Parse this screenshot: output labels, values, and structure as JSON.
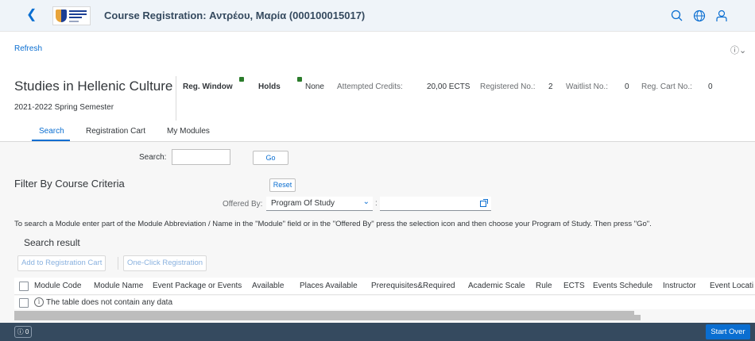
{
  "shell": {
    "title": "Course Registration: Αντρέου, Μαρία (000100015017)",
    "back_icon": "chevron-left-icon",
    "icons": [
      "search-icon",
      "globe-icon",
      "user-icon"
    ]
  },
  "refresh_label": "Refresh",
  "header": {
    "program_title": "Studies in Hellenic Culture",
    "semester": "2021-2022 Spring Semester",
    "reg_window_label": "Reg. Window",
    "holds_label": "Holds",
    "holds_value": "None",
    "attempted_credits_label": "Attempted Credits:",
    "attempted_credits_value": "20,00 ECTS",
    "registered_no_label": "Registered No.:",
    "registered_no_value": "2",
    "waitlist_no_label": "Waitlist No.:",
    "waitlist_no_value": "0",
    "reg_cart_no_label": "Reg. Cart No.:",
    "reg_cart_no_value": "0",
    "status_color": "#2b7c2b"
  },
  "tabs": [
    {
      "label": "Search",
      "active": true
    },
    {
      "label": "Registration Cart",
      "active": false
    },
    {
      "label": "My Modules",
      "active": false
    }
  ],
  "search": {
    "label": "Search:",
    "value": "",
    "go_label": "Go"
  },
  "filter": {
    "title": "Filter By Course Criteria",
    "reset_label": "Reset",
    "offered_by_label": "Offered By:",
    "offered_by_value": "Program Of Study",
    "offered_colon": ":",
    "offered_input_value": ""
  },
  "instructions": "To search a Module enter part of the Module Abbreviation / Name in the \"Module\" field or in the \"Offered By\" press the selection icon and then choose your Program of Study. Then press \"Go\".",
  "results": {
    "title": "Search result",
    "add_to_cart_label": "Add to Registration Cart",
    "one_click_label": "One-Click Registration",
    "columns": [
      "Module Code",
      "Module Name",
      "Event Package or Events",
      "Available",
      "Places Available",
      "Prerequisites&Required",
      "Academic Scale",
      "Rule",
      "ECTS",
      "Events Schedule",
      "Instructor",
      "Event Locati"
    ],
    "empty_message": "The table does not contain any data"
  },
  "footer": {
    "message_count": "0",
    "start_over_label": "Start Over"
  },
  "colors": {
    "accent": "#0a6ed1",
    "shell_bg": "#eff4f9",
    "footer_bg": "#354a5f"
  }
}
